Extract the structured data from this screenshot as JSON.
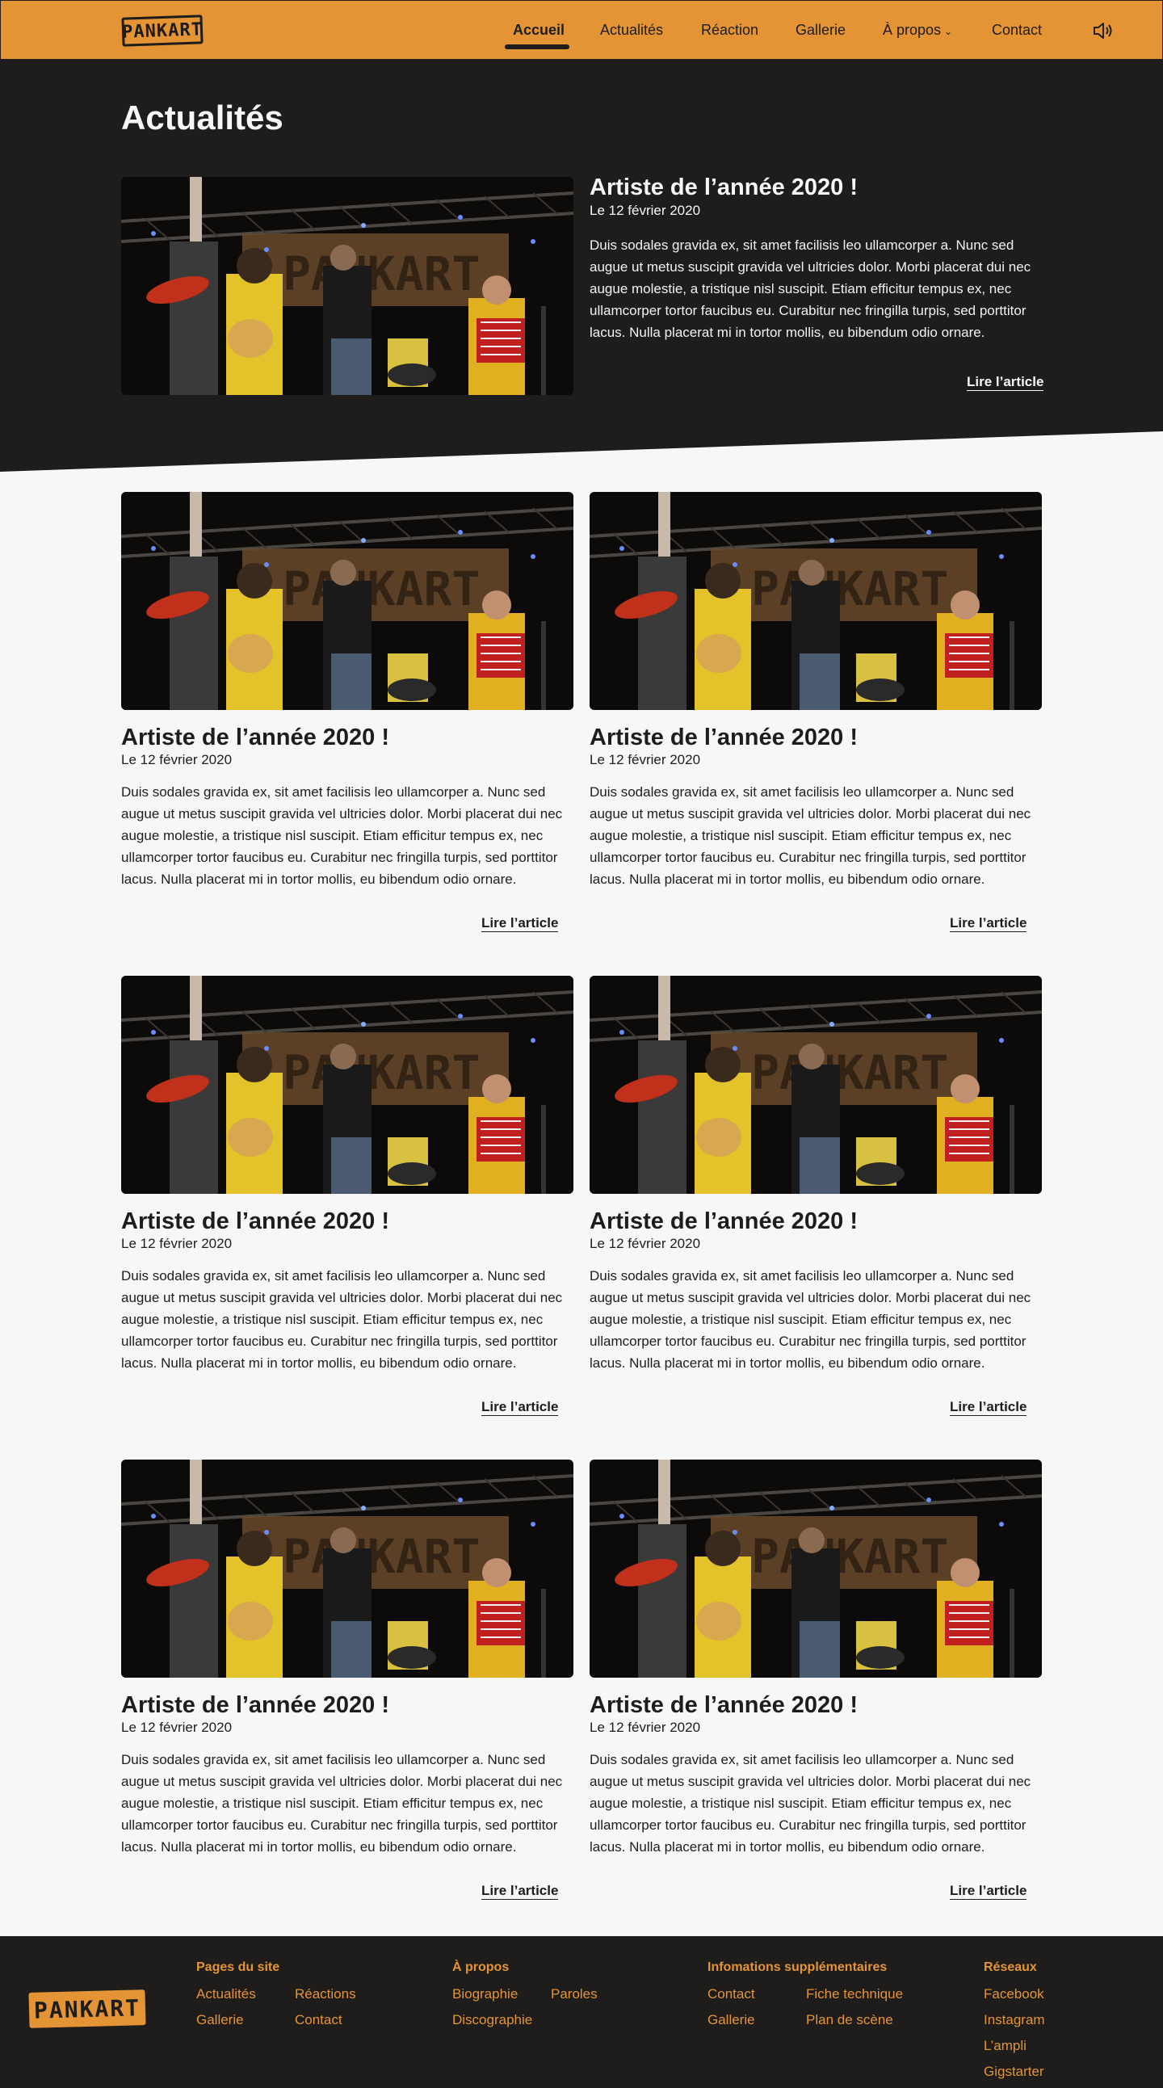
{
  "header": {
    "logo_text": "PANKART",
    "nav": [
      "Accueil",
      "Actualités",
      "Réaction",
      "Gallerie",
      "À propos",
      "Contact"
    ],
    "active": "Accueil",
    "sound_icon": "speaker-icon"
  },
  "hero": {
    "page_title": "Actualités",
    "feature": {
      "title": "Artiste de l’année 2020 !",
      "date": "Le 12 février 2020",
      "body": "Duis sodales gravida ex, sit amet facilisis leo ullamcorper a. Nunc sed augue ut metus suscipit gravida vel ultricies dolor. Morbi placerat dui nec augue molestie, a tristique nisl suscipit. Etiam efficitur tempus ex, nec ullamcorper tortor faucibus eu. Curabitur nec fringilla turpis, sed porttitor lacus. Nulla placerat mi in tortor mollis, eu bibendum odio ornare.",
      "link": "Lire l’article",
      "image": "concert-band-photo"
    }
  },
  "articles": [
    {
      "title": "Artiste de l’année 2020 !",
      "date": "Le 12 février 2020",
      "body": "Duis sodales gravida ex, sit amet facilisis leo ullamcorper a. Nunc sed augue ut metus suscipit gravida vel ultricies dolor. Morbi placerat dui nec augue molestie, a tristique nisl suscipit. Etiam efficitur tempus ex, nec ullamcorper tortor faucibus eu. Curabitur nec fringilla turpis, sed porttitor lacus. Nulla placerat mi in tortor mollis, eu bibendum odio ornare.",
      "link": "Lire l’article"
    },
    {
      "title": "Artiste de l’année 2020 !",
      "date": "Le 12 février 2020",
      "body": "Duis sodales gravida ex, sit amet facilisis leo ullamcorper a. Nunc sed augue ut metus suscipit gravida vel ultricies dolor. Morbi placerat dui nec augue molestie, a tristique nisl suscipit. Etiam efficitur tempus ex, nec ullamcorper tortor faucibus eu. Curabitur nec fringilla turpis, sed porttitor lacus. Nulla placerat mi in tortor mollis, eu bibendum odio ornare.",
      "link": "Lire l’article"
    },
    {
      "title": "Artiste de l’année 2020 !",
      "date": "Le 12 février 2020",
      "body": "Duis sodales gravida ex, sit amet facilisis leo ullamcorper a. Nunc sed augue ut metus suscipit gravida vel ultricies dolor. Morbi placerat dui nec augue molestie, a tristique nisl suscipit. Etiam efficitur tempus ex, nec ullamcorper tortor faucibus eu. Curabitur nec fringilla turpis, sed porttitor lacus. Nulla placerat mi in tortor mollis, eu bibendum odio ornare.",
      "link": "Lire l’article"
    },
    {
      "title": "Artiste de l’année 2020 !",
      "date": "Le 12 février 2020",
      "body": "Duis sodales gravida ex, sit amet facilisis leo ullamcorper a. Nunc sed augue ut metus suscipit gravida vel ultricies dolor. Morbi placerat dui nec augue molestie, a tristique nisl suscipit. Etiam efficitur tempus ex, nec ullamcorper tortor faucibus eu. Curabitur nec fringilla turpis, sed porttitor lacus. Nulla placerat mi in tortor mollis, eu bibendum odio ornare.",
      "link": "Lire l’article"
    },
    {
      "title": "Artiste de l’année 2020 !",
      "date": "Le 12 février 2020",
      "body": "Duis sodales gravida ex, sit amet facilisis leo ullamcorper a. Nunc sed augue ut metus suscipit gravida vel ultricies dolor. Morbi placerat dui nec augue molestie, a tristique nisl suscipit. Etiam efficitur tempus ex, nec ullamcorper tortor faucibus eu. Curabitur nec fringilla turpis, sed porttitor lacus. Nulla placerat mi in tortor mollis, eu bibendum odio ornare.",
      "link": "Lire l’article"
    },
    {
      "title": "Artiste de l’année 2020 !",
      "date": "Le 12 février 2020",
      "body": "Duis sodales gravida ex, sit amet facilisis leo ullamcorper a. Nunc sed augue ut metus suscipit gravida vel ultricies dolor. Morbi placerat dui nec augue molestie, a tristique nisl suscipit. Etiam efficitur tempus ex, nec ullamcorper tortor faucibus eu. Curabitur nec fringilla turpis, sed porttitor lacus. Nulla placerat mi in tortor mollis, eu bibendum odio ornare.",
      "link": "Lire l’article"
    }
  ],
  "footer": {
    "logo_text": "PANKART",
    "columns": [
      {
        "heading": "Pages du site",
        "links": [
          "Actualités",
          "Réactions",
          "Gallerie",
          "Contact"
        ]
      },
      {
        "heading": "À propos",
        "links": [
          "Biographie",
          "Paroles",
          "Discographie"
        ]
      },
      {
        "heading": "Infomations supplémentaires",
        "links": [
          "Contact",
          "Fiche technique",
          "Gallerie",
          "Plan de scène"
        ]
      },
      {
        "heading": "Réseaux",
        "links": [
          "Facebook",
          "Instagram",
          "L’ampli",
          "Gigstarter"
        ]
      }
    ]
  },
  "colors": {
    "accent": "#e49434",
    "dark": "#1e1d1c",
    "light": "#f7f7f7"
  }
}
